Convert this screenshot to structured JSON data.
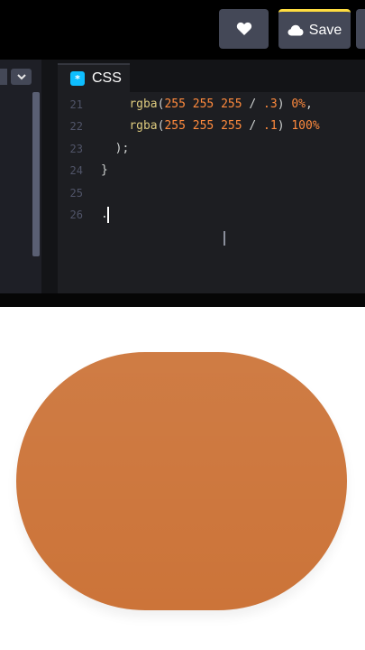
{
  "toolbar": {
    "heart_icon": "heart-icon",
    "save_label": "Save",
    "cloud_icon": "cloud-icon"
  },
  "left_editor": {
    "dropdown_icon": "chevron-down-icon"
  },
  "css_editor": {
    "tab_label": "CSS",
    "tab_icon": "*",
    "lines": [
      {
        "number": "21",
        "parts": [
          {
            "t": "rgba",
            "c": "kw"
          },
          {
            "t": "(",
            "c": "pun"
          },
          {
            "t": "255 255 255",
            "c": "num"
          },
          {
            "t": " / ",
            "c": "pun"
          },
          {
            "t": ".3",
            "c": "num"
          },
          {
            "t": ") ",
            "c": "pun"
          },
          {
            "t": "0%",
            "c": "num"
          },
          {
            "t": ",",
            "c": "pun"
          }
        ],
        "indent": "    "
      },
      {
        "number": "22",
        "parts": [
          {
            "t": "rgba",
            "c": "kw"
          },
          {
            "t": "(",
            "c": "pun"
          },
          {
            "t": "255 255 255",
            "c": "num"
          },
          {
            "t": " / ",
            "c": "pun"
          },
          {
            "t": ".1",
            "c": "num"
          },
          {
            "t": ") ",
            "c": "pun"
          },
          {
            "t": "100%",
            "c": "num"
          }
        ],
        "indent": "    "
      },
      {
        "number": "23",
        "parts": [
          {
            "t": ");",
            "c": "pun"
          }
        ],
        "indent": "  "
      },
      {
        "number": "24",
        "parts": [
          {
            "t": "}",
            "c": "pun"
          }
        ],
        "indent": ""
      },
      {
        "number": "25",
        "parts": [],
        "indent": ""
      },
      {
        "number": "26",
        "parts": [
          {
            "t": ".",
            "c": "pun"
          }
        ],
        "indent": ""
      }
    ]
  },
  "colors": {
    "shape": "#cc7439",
    "accent_save": "#ffdd40",
    "tab_icon": "#0ebeff"
  }
}
